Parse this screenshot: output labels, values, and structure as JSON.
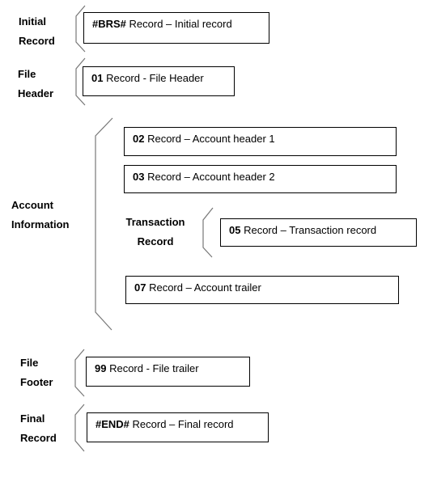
{
  "sections": {
    "initial": {
      "label": [
        "Initial",
        "Record"
      ],
      "box": {
        "code": "#BRS#",
        "text": " Record – Initial record"
      }
    },
    "file_header": {
      "label": [
        "File",
        "Header"
      ],
      "box": {
        "code": "01",
        "text": " Record - File Header"
      }
    },
    "account": {
      "label": [
        "Account",
        "Information"
      ],
      "boxes": [
        {
          "code": "02",
          "text": " Record – Account header 1"
        },
        {
          "code": "03",
          "text": " Record – Account header 2"
        },
        {
          "code": "07",
          "text": " Record – Account trailer"
        }
      ],
      "transaction": {
        "label": [
          "Transaction",
          "Record"
        ],
        "box": {
          "code": "05",
          "text": " Record – Transaction record"
        }
      }
    },
    "file_footer": {
      "label": [
        "File",
        "Footer"
      ],
      "box": {
        "code": "99",
        "text": " Record - File trailer"
      }
    },
    "final": {
      "label": [
        "Final",
        "Record"
      ],
      "box": {
        "code": "#END#",
        "text": " Record – Final record"
      }
    }
  },
  "colors": {
    "bracket": "#777777",
    "box_border": "#000000"
  }
}
